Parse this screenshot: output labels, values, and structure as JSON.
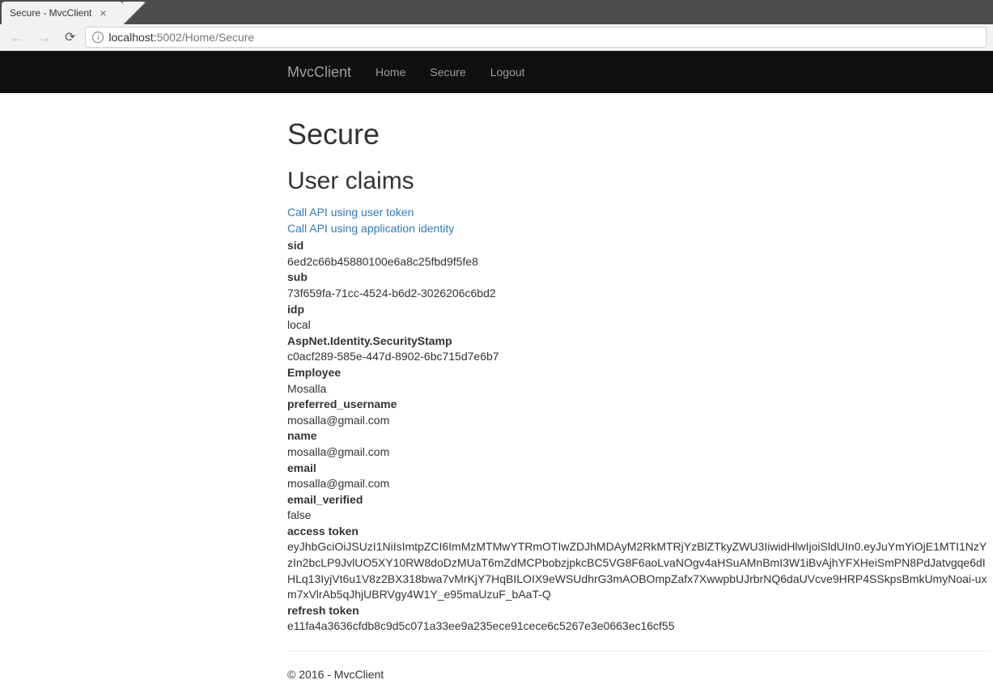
{
  "browser": {
    "tab_title": "Secure - MvcClient",
    "url_host": "localhost:",
    "url_port_path": "5002/Home/Secure"
  },
  "navbar": {
    "brand": "MvcClient",
    "links": {
      "home": "Home",
      "secure": "Secure",
      "logout": "Logout"
    }
  },
  "page": {
    "title": "Secure",
    "subtitle": "User claims"
  },
  "links": {
    "api_user": "Call API using user token",
    "api_app": "Call API using application identity"
  },
  "claims": {
    "sid": {
      "label": "sid",
      "value": "6ed2c66b45880100e6a8c25fbd9f5fe8"
    },
    "sub": {
      "label": "sub",
      "value": "73f659fa-71cc-4524-b6d2-3026206c6bd2"
    },
    "idp": {
      "label": "idp",
      "value": "local"
    },
    "securitystamp": {
      "label": "AspNet.Identity.SecurityStamp",
      "value": "c0acf289-585e-447d-8902-6bc715d7e6b7"
    },
    "employee": {
      "label": "Employee",
      "value": "Mosalla"
    },
    "preferred_username": {
      "label": "preferred_username",
      "value": "mosalla@gmail.com"
    },
    "name": {
      "label": "name",
      "value": "mosalla@gmail.com"
    },
    "email": {
      "label": "email",
      "value": "mosalla@gmail.com"
    },
    "email_verified": {
      "label": "email_verified",
      "value": "false"
    },
    "access_token": {
      "label": "access token",
      "value": "eyJhbGciOiJSUzI1NiIsImtpZCI6ImMzMTMwYTRmOTIwZDJhMDAyM2RkMTRjYzBlZTkyZWU3IiwidHlwIjoiSldUIn0.eyJuYmYiOjE1MTI1NzYzIn2bcLP9JvlUO5XY10RW8doDzMUaT6mZdMCPbobzjpkcBC5VG8F6aoLvaNOgv4aHSuAMnBmI3W1iBvAjhYFXHeiSmPN8PdJatvgqe6dIHLq13IyjVt6u1V8z2BX318bwa7vMrKjY7HqBILOIX9eWSUdhrG3mAOBOmpZafx7XwwpbUJrbrNQ6daUVcve9HRP4SSkpsBmkUmyNoai-uxm7xVlrAb5qJhjUBRVgy4W1Y_e95maUzuF_bAaT-Q"
    },
    "refresh_token": {
      "label": "refresh token",
      "value": "e11fa4a3636cfdb8c9d5c071a33ee9a235ece91cece6c5267e3e0663ec16cf55"
    }
  },
  "footer": "© 2016 - MvcClient"
}
